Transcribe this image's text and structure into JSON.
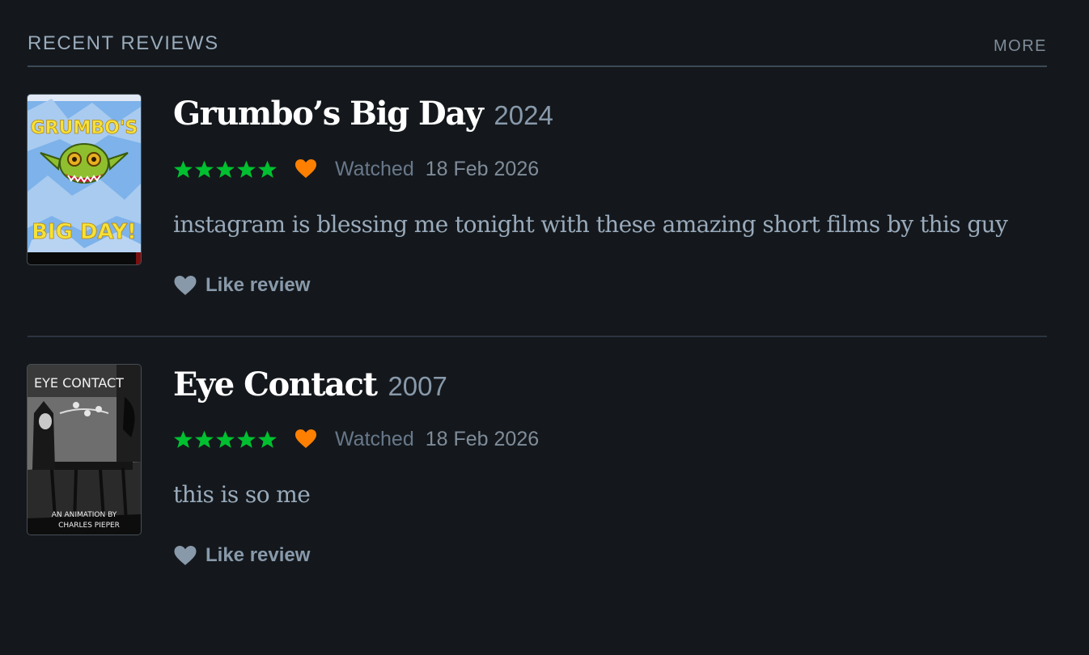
{
  "section": {
    "title": "RECENT REVIEWS",
    "more_label": "MORE"
  },
  "colors": {
    "background": "#14181c",
    "star_green": "#00c030",
    "liked_orange": "#ff8000",
    "muted_text": "#99aabb"
  },
  "reviews": [
    {
      "film_title": "Grumbo’s Big Day",
      "year": "2024",
      "rating_stars": 5,
      "liked": true,
      "watched_label": "Watched",
      "watched_date": "18 Feb 2026",
      "body": "instagram is blessing me tonight with these amazing short films by this guy",
      "like_label": "Like review",
      "poster": {
        "top_text": "GRUMBO'S",
        "bottom_text": "BIG DAY!"
      }
    },
    {
      "film_title": "Eye Contact",
      "year": "2007",
      "rating_stars": 5,
      "liked": true,
      "watched_label": "Watched",
      "watched_date": "18 Feb 2026",
      "body": "this is so me",
      "like_label": "Like review",
      "poster": {
        "top_text": "EYE CONTACT",
        "credit_line_1": "AN ANIMATION BY",
        "credit_line_2": "CHARLES PIEPER"
      }
    }
  ]
}
